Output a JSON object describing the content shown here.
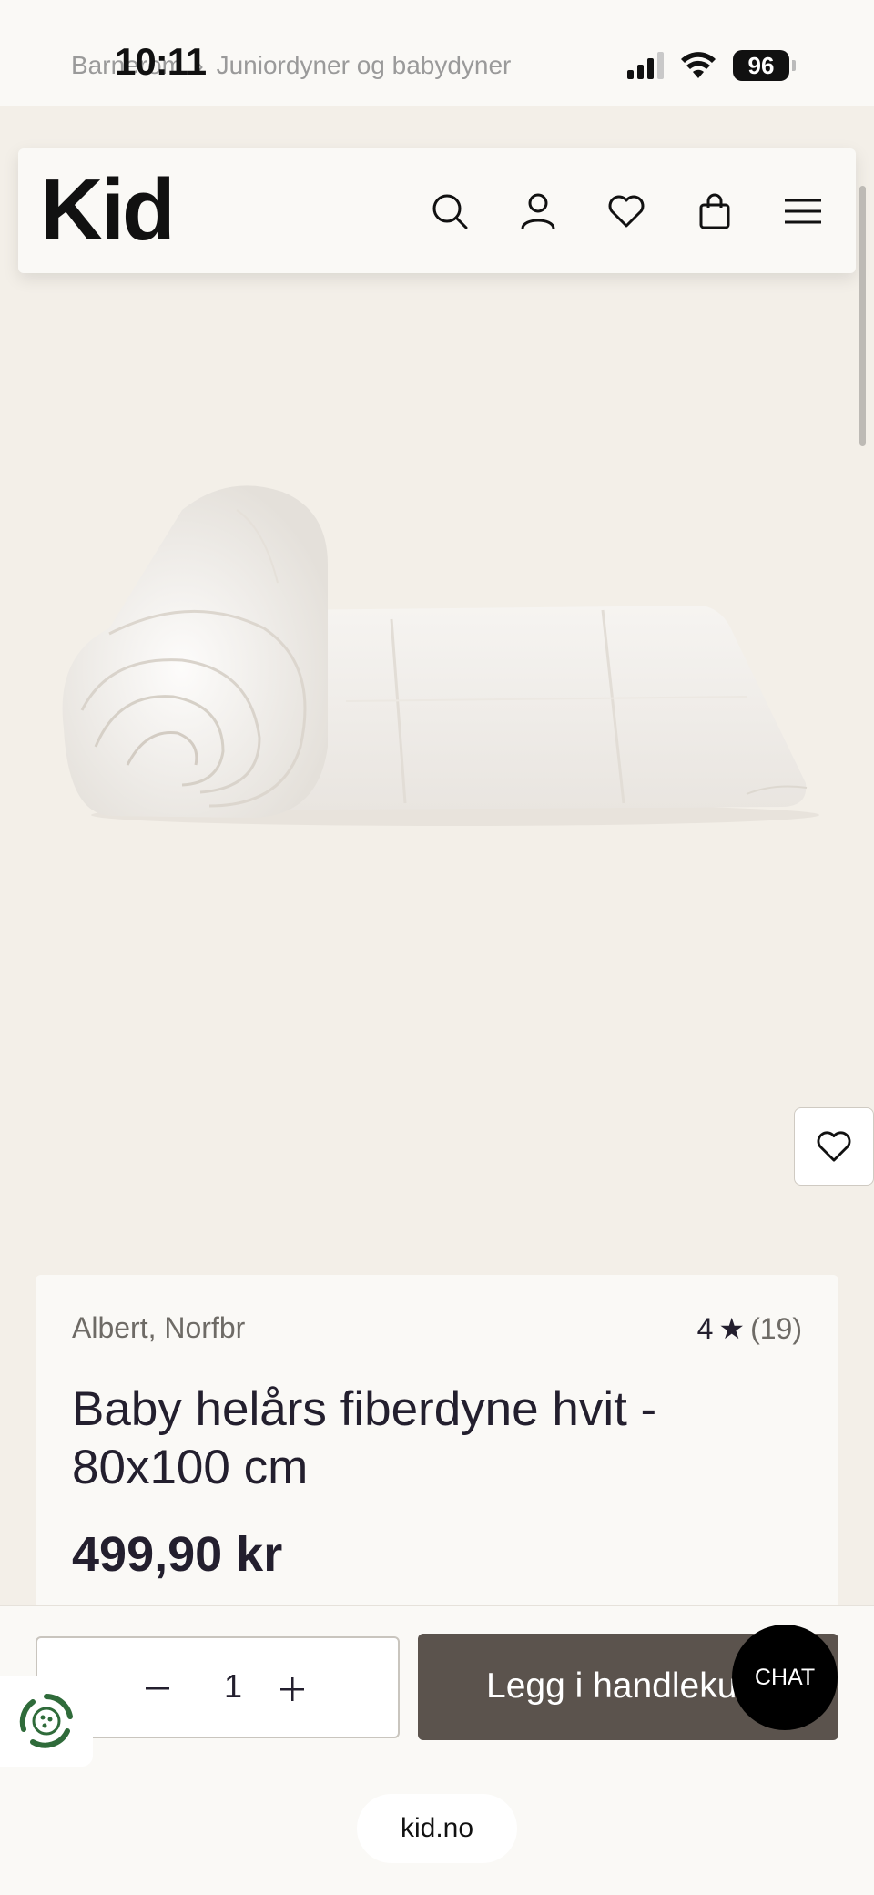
{
  "status_bar": {
    "time": "10:11",
    "battery": "96",
    "signal_icon": "cellular-signal-icon",
    "wifi_icon": "wifi-icon"
  },
  "breadcrumb": {
    "items": [
      "Barnerom",
      "Juniordyner og babydyner"
    ]
  },
  "header": {
    "logo": "Kid",
    "icons": [
      "search-icon",
      "account-icon",
      "heart-icon",
      "bag-icon",
      "menu-icon"
    ]
  },
  "product": {
    "brand": "Albert, Norfbr",
    "rating": "4",
    "rating_count": "(19)",
    "title": "Baby helårs fiberdyne hvit - 80x100 cm",
    "price": "499,90 kr"
  },
  "cart": {
    "quantity": "1",
    "add_label": "Legg i handlekurv",
    "chat_label": "CHAT"
  },
  "browser": {
    "url": "kid.no"
  },
  "colors": {
    "page_bg": "#f3efe8",
    "card_bg": "#faf9f6",
    "button_bg": "#5b534d",
    "text": "#231f2e"
  }
}
